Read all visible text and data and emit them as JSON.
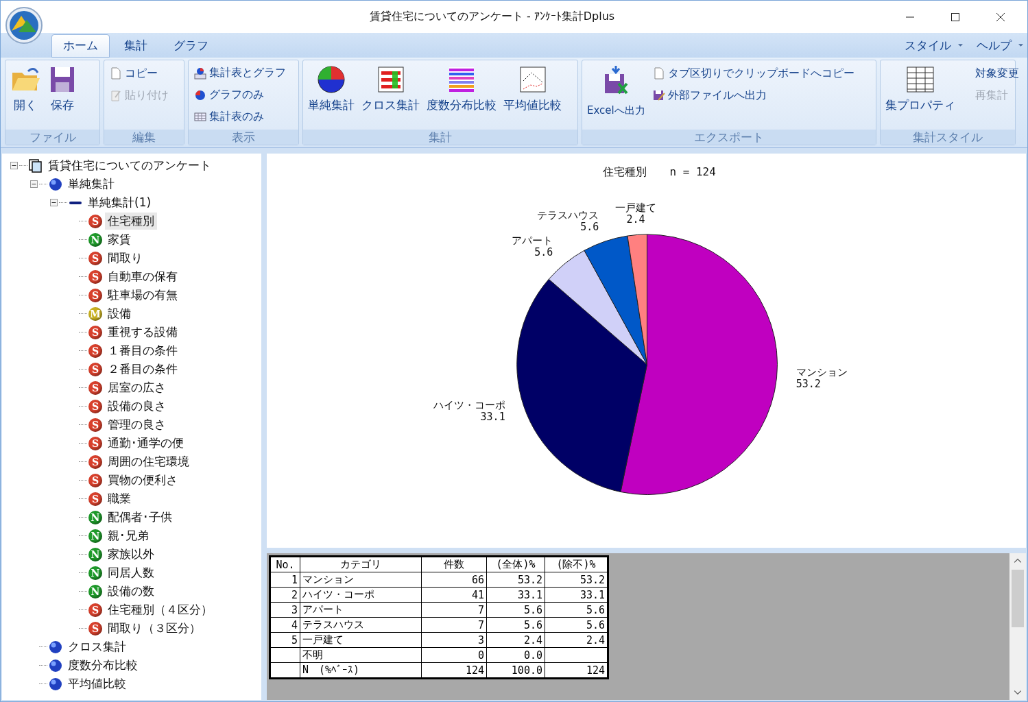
{
  "window": {
    "title": "賃貸住宅についてのアンケート - ｱﾝｹｰﾄ集計Dplus"
  },
  "ribbon": {
    "tabs": [
      {
        "label": "ホーム",
        "selected": true
      },
      {
        "label": "集計",
        "selected": false
      },
      {
        "label": "グラフ",
        "selected": false
      }
    ],
    "menus": [
      "スタイル",
      "ヘルプ"
    ],
    "groups": [
      {
        "label": "ファイル",
        "buttons": [
          {
            "label": "開く",
            "kind": "large",
            "disabled": false
          },
          {
            "label": "保存",
            "kind": "large",
            "disabled": false
          }
        ]
      },
      {
        "label": "編集",
        "buttons": [
          {
            "label": "コピー",
            "kind": "small",
            "disabled": false
          },
          {
            "label": "貼り付け",
            "kind": "small",
            "disabled": true
          }
        ]
      },
      {
        "label": "表示",
        "buttons": [
          {
            "label": "集計表とグラフ",
            "kind": "small",
            "disabled": false
          },
          {
            "label": "グラフのみ",
            "kind": "small",
            "disabled": false
          },
          {
            "label": "集計表のみ",
            "kind": "small",
            "disabled": false
          }
        ]
      },
      {
        "label": "集計",
        "buttons": [
          {
            "label": "単純集計",
            "kind": "large",
            "disabled": false
          },
          {
            "label": "クロス集計",
            "kind": "large",
            "disabled": false
          },
          {
            "label": "度数分布比較",
            "kind": "large",
            "disabled": false
          },
          {
            "label": "平均値比較",
            "kind": "large",
            "disabled": false
          }
        ]
      },
      {
        "label": "エクスポート",
        "buttons": [
          {
            "label": "Excelへ出力",
            "kind": "large",
            "disabled": false
          },
          {
            "label": "タブ区切りでクリップボードへコピー",
            "kind": "small",
            "disabled": false
          },
          {
            "label": "外部ファイルへ出力",
            "kind": "small",
            "disabled": false
          }
        ]
      },
      {
        "label": "集計スタイル",
        "buttons": [
          {
            "label": "集プロパティ",
            "kind": "large",
            "disabled": false
          },
          {
            "label": "対象変更",
            "kind": "small",
            "disabled": false
          },
          {
            "label": "再集計",
            "kind": "small",
            "disabled": true
          }
        ]
      }
    ]
  },
  "tree": [
    {
      "label": "賃貸住宅についてのアンケート",
      "kind": "document",
      "expanded": true,
      "selected": false,
      "children": [
        {
          "label": "単純集計",
          "kind": "group",
          "expanded": true,
          "selected": false,
          "children": [
            {
              "label": "単純集計(1)",
              "kind": "set",
              "expanded": true,
              "selected": false,
              "children": [
                {
                  "label": "住宅種別",
                  "kind": "variable",
                  "badge": "S",
                  "color": "#d8402c",
                  "selected": true
                },
                {
                  "label": "家賃",
                  "kind": "variable",
                  "badge": "N",
                  "color": "#1e9a2a",
                  "selected": false
                },
                {
                  "label": "間取り",
                  "kind": "variable",
                  "badge": "S",
                  "color": "#d8402c",
                  "selected": false
                },
                {
                  "label": "自動車の保有",
                  "kind": "variable",
                  "badge": "S",
                  "color": "#d8402c",
                  "selected": false
                },
                {
                  "label": "駐車場の有無",
                  "kind": "variable",
                  "badge": "S",
                  "color": "#d8402c",
                  "selected": false
                },
                {
                  "label": "設備",
                  "kind": "variable",
                  "badge": "M",
                  "color": "#c8b020",
                  "selected": false
                },
                {
                  "label": "重視する設備",
                  "kind": "variable",
                  "badge": "S",
                  "color": "#d8402c",
                  "selected": false
                },
                {
                  "label": "１番目の条件",
                  "kind": "variable",
                  "badge": "S",
                  "color": "#d8402c",
                  "selected": false
                },
                {
                  "label": "２番目の条件",
                  "kind": "variable",
                  "badge": "S",
                  "color": "#d8402c",
                  "selected": false
                },
                {
                  "label": "居室の広さ",
                  "kind": "variable",
                  "badge": "S",
                  "color": "#d8402c",
                  "selected": false
                },
                {
                  "label": "設備の良さ",
                  "kind": "variable",
                  "badge": "S",
                  "color": "#d8402c",
                  "selected": false
                },
                {
                  "label": "管理の良さ",
                  "kind": "variable",
                  "badge": "S",
                  "color": "#d8402c",
                  "selected": false
                },
                {
                  "label": "通勤･通学の便",
                  "kind": "variable",
                  "badge": "S",
                  "color": "#d8402c",
                  "selected": false
                },
                {
                  "label": "周囲の住宅環境",
                  "kind": "variable",
                  "badge": "S",
                  "color": "#d8402c",
                  "selected": false
                },
                {
                  "label": "買物の便利さ",
                  "kind": "variable",
                  "badge": "S",
                  "color": "#d8402c",
                  "selected": false
                },
                {
                  "label": "職業",
                  "kind": "variable",
                  "badge": "S",
                  "color": "#d8402c",
                  "selected": false
                },
                {
                  "label": "配偶者･子供",
                  "kind": "variable",
                  "badge": "N",
                  "color": "#1e9a2a",
                  "selected": false
                },
                {
                  "label": "親･兄弟",
                  "kind": "variable",
                  "badge": "N",
                  "color": "#1e9a2a",
                  "selected": false
                },
                {
                  "label": "家族以外",
                  "kind": "variable",
                  "badge": "N",
                  "color": "#1e9a2a",
                  "selected": false
                },
                {
                  "label": "同居人数",
                  "kind": "variable",
                  "badge": "N",
                  "color": "#1e9a2a",
                  "selected": false
                },
                {
                  "label": "設備の数",
                  "kind": "variable",
                  "badge": "N",
                  "color": "#1e9a2a",
                  "selected": false
                },
                {
                  "label": "住宅種別（４区分）",
                  "kind": "variable",
                  "badge": "S",
                  "color": "#d8402c",
                  "selected": false
                },
                {
                  "label": "間取り（３区分）",
                  "kind": "variable",
                  "badge": "S",
                  "color": "#d8402c",
                  "selected": false
                }
              ]
            }
          ]
        },
        {
          "label": "クロス集計",
          "kind": "group",
          "selected": false
        },
        {
          "label": "度数分布比較",
          "kind": "group",
          "selected": false
        },
        {
          "label": "平均値比較",
          "kind": "group",
          "selected": false
        }
      ]
    }
  ],
  "chart": {
    "chart_data": {
      "type": "pie",
      "title": "住宅種別",
      "annotations": [
        "n = 124"
      ],
      "categories": [
        "マンション",
        "ハイツ・コーポ",
        "アパート",
        "テラスハウス",
        "一戸建て"
      ],
      "values": [
        53.2,
        33.1,
        5.6,
        5.6,
        2.4
      ],
      "colors": [
        "#c000c0",
        "#000066",
        "#d0d0f8",
        "#0058c8",
        "#ff8080"
      ],
      "data_labels": true
    }
  },
  "table": {
    "columns": [
      "No.",
      "カテゴリ",
      "件数",
      "(全体)%",
      "(除不)%"
    ],
    "rows": [
      [
        "1",
        "マンション",
        "66",
        "53.2",
        "53.2"
      ],
      [
        "2",
        "ハイツ・コーポ",
        "41",
        "33.1",
        "33.1"
      ],
      [
        "3",
        "アパート",
        "7",
        "5.6",
        "5.6"
      ],
      [
        "4",
        "テラスハウス",
        "7",
        "5.6",
        "5.6"
      ],
      [
        "5",
        "一戸建て",
        "3",
        "2.4",
        "2.4"
      ],
      [
        null,
        "不明",
        "0",
        "0.0",
        null
      ],
      [
        null,
        "N　(%ﾍﾞｰｽ)",
        "124",
        "100.0",
        "124"
      ]
    ]
  }
}
